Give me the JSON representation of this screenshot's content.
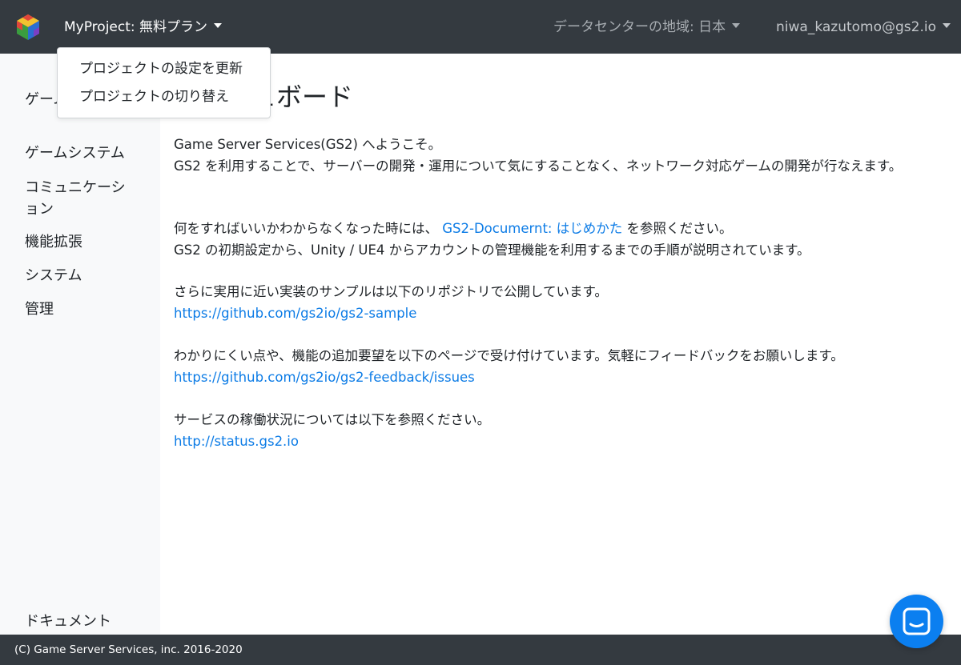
{
  "colors": {
    "topbar": "#343a40",
    "sidebar": "#f8f9fa",
    "link": "#0d7ce6",
    "chat_button": "#0b7ff0",
    "footer": "#343a40"
  },
  "header": {
    "logo_icon": "cube-logo-icon",
    "project_label": "MyProject: 無料プラン",
    "region_label": "データセンターの地域: 日本",
    "user_label": "niwa_kazutomo@gs2.io"
  },
  "project_menu": {
    "items": [
      {
        "label": "プロジェクトの設定を更新"
      },
      {
        "label": "プロジェクトの切り替え"
      }
    ]
  },
  "sidebar": {
    "items": [
      {
        "label": "ゲームサーバー"
      },
      {
        "label": "ゲームシステム"
      },
      {
        "label": "コミュニケーション"
      },
      {
        "label": "機能拡張"
      },
      {
        "label": "システム"
      },
      {
        "label": "管理"
      }
    ],
    "bottom_label": "ドキュメント"
  },
  "main": {
    "title": "ダッシュボード",
    "intro_line1": "Game Server Services(GS2) へようこそ。",
    "intro_line2": "GS2 を利用することで、サーバーの開発・運用について気にすることなく、ネットワーク対応ゲームの開発が行なえます。",
    "docs_before": "何をすればいいかわからなくなった時には、",
    "docs_link": "GS2-Documernt: はじめかた",
    "docs_after": "を参照ください。",
    "docs_line2": "GS2 の初期設定から、Unity / UE4 からアカウントの管理機能を利用するまでの手順が説明されています。",
    "sample_text": "さらに実用に近い実装のサンプルは以下のリポジトリで公開しています。",
    "sample_link": "https://github.com/gs2io/gs2-sample",
    "feedback_text": "わかりにくい点や、機能の追加要望を以下のページで受け付けています。気軽にフィードバックをお願いします。",
    "feedback_link": "https://github.com/gs2io/gs2-feedback/issues",
    "status_text": "サービスの稼働状況については以下を参照ください。",
    "status_link": "http://status.gs2.io"
  },
  "footer": {
    "copyright": "(C) Game Server Services, inc. 2016-2020"
  },
  "chat": {
    "icon": "chat-bubble-icon"
  }
}
